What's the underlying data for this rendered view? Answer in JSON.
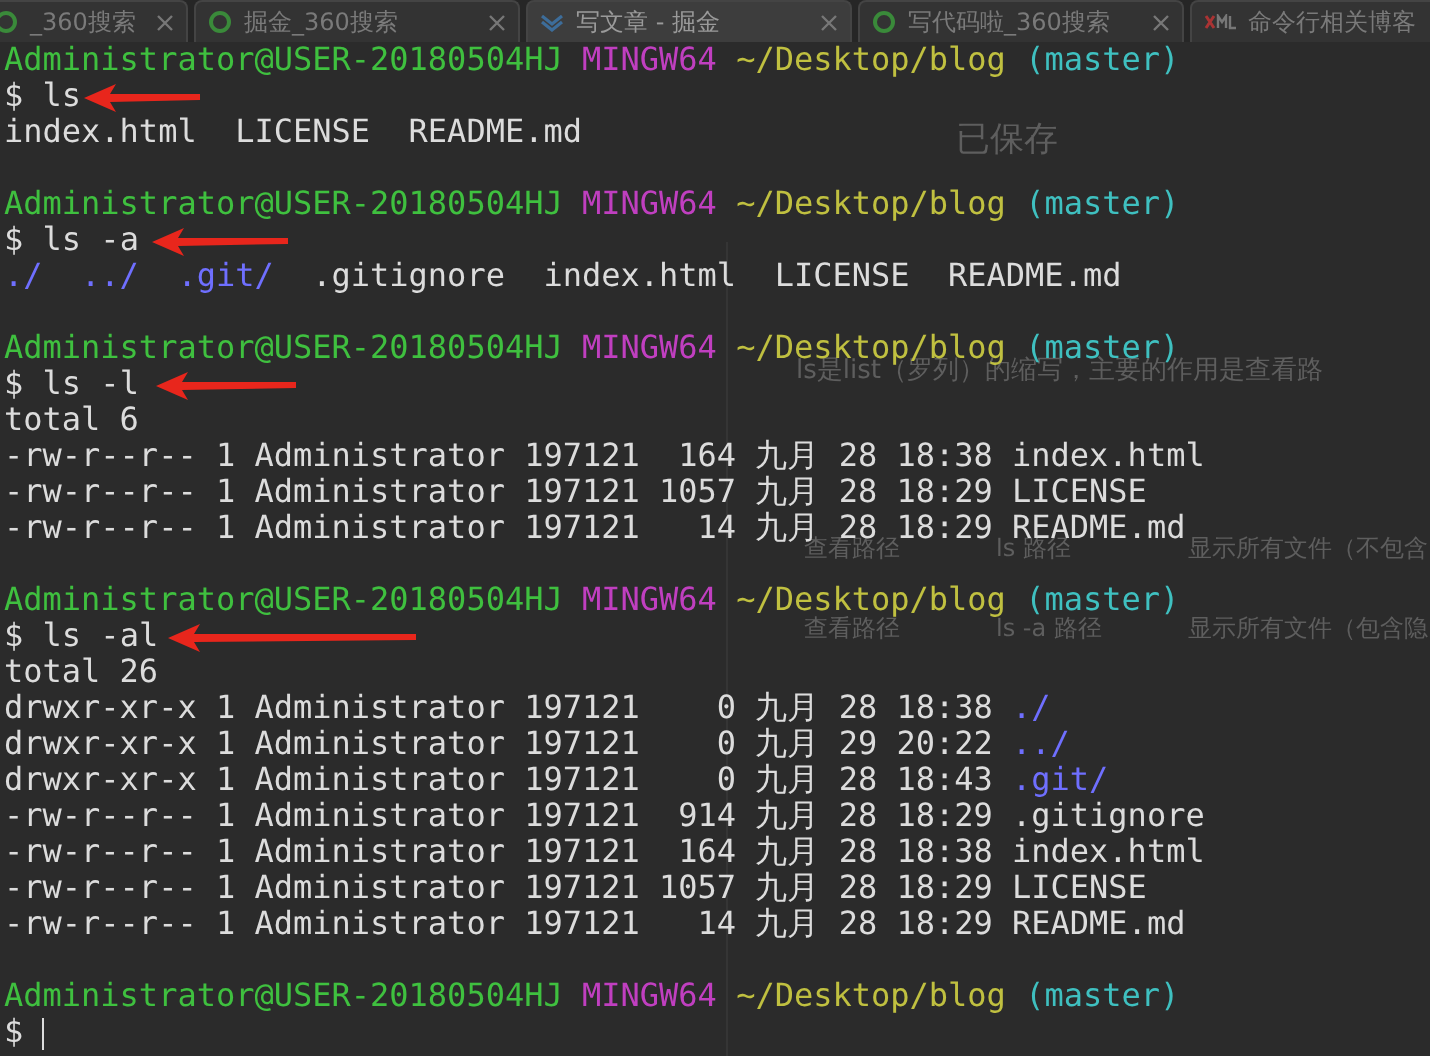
{
  "browser_tabs": [
    {
      "label": "_360搜索",
      "kind": "search",
      "selected": false
    },
    {
      "label": "掘金_360搜索",
      "kind": "search",
      "selected": false
    },
    {
      "label": "写文章 - 掘金",
      "kind": "article",
      "selected": true
    },
    {
      "label": "写代码啦_360搜索",
      "kind": "search",
      "selected": false
    },
    {
      "label": "命令行相关博客",
      "kind": "blog",
      "selected": false
    }
  ],
  "background_page": {
    "save_status": "已保存",
    "intro": "ls是list（罗列）的缩写，主要的作用是查看路",
    "rows": [
      {
        "operation": "查看路径",
        "command": "ls 路径",
        "description": "显示所有文件（不包含"
      },
      {
        "operation": "查看路径",
        "command": "ls -a 路径",
        "description": "显示所有文件（包含隐"
      }
    ]
  },
  "terminal": {
    "lines": [
      {
        "kind": "prompt",
        "user": "Administrator@USER-20180504HJ",
        "system": "MINGW64",
        "path": "~/Desktop/blog",
        "branch": "(master)"
      },
      {
        "kind": "command",
        "symbol": "$",
        "text": "ls",
        "arrow": true
      },
      {
        "kind": "output",
        "segments": [
          {
            "text": "index.html  LICENSE  README.md",
            "dir": false
          }
        ]
      },
      {
        "kind": "blank"
      },
      {
        "kind": "prompt",
        "user": "Administrator@USER-20180504HJ",
        "system": "MINGW64",
        "path": "~/Desktop/blog",
        "branch": "(master)"
      },
      {
        "kind": "command",
        "symbol": "$",
        "text": "ls -a",
        "arrow": true
      },
      {
        "kind": "output",
        "segments": [
          {
            "text": "./  ../  .git/",
            "dir": true
          },
          {
            "text": "  .gitignore  index.html  LICENSE  README.md",
            "dir": false
          }
        ]
      },
      {
        "kind": "blank"
      },
      {
        "kind": "prompt",
        "user": "Administrator@USER-20180504HJ",
        "system": "MINGW64",
        "path": "~/Desktop/blog",
        "branch": "(master)"
      },
      {
        "kind": "command",
        "symbol": "$",
        "text": "ls -l",
        "arrow": true
      },
      {
        "kind": "output",
        "segments": [
          {
            "text": "total 6",
            "dir": false
          }
        ]
      },
      {
        "kind": "output",
        "segments": [
          {
            "text": "-rw-r--r-- 1 Administrator 197121  164 九月 28 18:38 index.html",
            "dir": false
          }
        ]
      },
      {
        "kind": "output",
        "segments": [
          {
            "text": "-rw-r--r-- 1 Administrator 197121 1057 九月 28 18:29 LICENSE",
            "dir": false
          }
        ]
      },
      {
        "kind": "output",
        "segments": [
          {
            "text": "-rw-r--r-- 1 Administrator 197121   14 九月 28 18:29 README.md",
            "dir": false
          }
        ]
      },
      {
        "kind": "blank"
      },
      {
        "kind": "prompt",
        "user": "Administrator@USER-20180504HJ",
        "system": "MINGW64",
        "path": "~/Desktop/blog",
        "branch": "(master)"
      },
      {
        "kind": "command",
        "symbol": "$",
        "text": "ls -al",
        "arrow": true
      },
      {
        "kind": "output",
        "segments": [
          {
            "text": "total 26",
            "dir": false
          }
        ]
      },
      {
        "kind": "output",
        "segments": [
          {
            "text": "drwxr-xr-x 1 Administrator 197121    0 九月 28 18:38",
            "dir": false
          },
          {
            "text": "./",
            "dir": true
          }
        ]
      },
      {
        "kind": "output",
        "segments": [
          {
            "text": "drwxr-xr-x 1 Administrator 197121    0 九月 29 20:22",
            "dir": false
          },
          {
            "text": "../",
            "dir": true
          }
        ]
      },
      {
        "kind": "output",
        "segments": [
          {
            "text": "drwxr-xr-x 1 Administrator 197121    0 九月 28 18:43",
            "dir": false
          },
          {
            "text": ".git/",
            "dir": true
          }
        ]
      },
      {
        "kind": "output",
        "segments": [
          {
            "text": "-rw-r--r-- 1 Administrator 197121  914 九月 28 18:29 .gitignore",
            "dir": false
          }
        ]
      },
      {
        "kind": "output",
        "segments": [
          {
            "text": "-rw-r--r-- 1 Administrator 197121  164 九月 28 18:38 index.html",
            "dir": false
          }
        ]
      },
      {
        "kind": "output",
        "segments": [
          {
            "text": "-rw-r--r-- 1 Administrator 197121 1057 九月 28 18:29 LICENSE",
            "dir": false
          }
        ]
      },
      {
        "kind": "output",
        "segments": [
          {
            "text": "-rw-r--r-- 1 Administrator 197121   14 九月 28 18:29 README.md",
            "dir": false
          }
        ]
      },
      {
        "kind": "blank"
      },
      {
        "kind": "prompt",
        "user": "Administrator@USER-20180504HJ",
        "system": "MINGW64",
        "path": "~/Desktop/blog",
        "branch": "(master)"
      },
      {
        "kind": "input",
        "symbol": "$",
        "cursor": true
      }
    ]
  }
}
